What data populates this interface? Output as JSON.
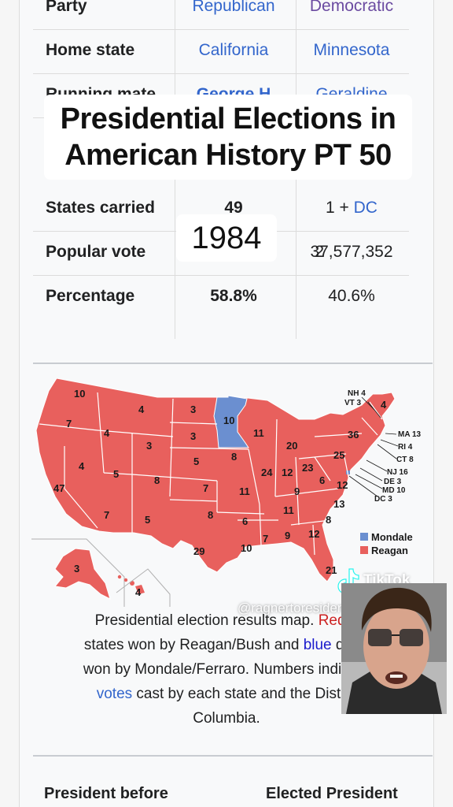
{
  "infobox": {
    "party": {
      "label": "Party",
      "rep": "Republican",
      "dem": "Democratic"
    },
    "home_state": {
      "label": "Home state",
      "rep": "California",
      "dem": "Minnesota"
    },
    "running_mate": {
      "label": "Running mate",
      "rep": "George H",
      "dem": "Geraldine"
    },
    "states_carried": {
      "label": "States carried",
      "rep": "49",
      "dem_num": "1 + ",
      "dem_link": "DC"
    },
    "popular_vote": {
      "label": "Popular vote",
      "rep": "2",
      "dem": "37,577,352"
    },
    "percentage": {
      "label": "Percentage",
      "rep": "58.8%",
      "dem": "40.6%"
    }
  },
  "overlay": {
    "title_line1": "Presidential Elections in",
    "title_line2": "American History PT 50",
    "year": "1984"
  },
  "map": {
    "colors": {
      "reagan": "#e8605d",
      "mondale": "#6b8fd0"
    },
    "legend": {
      "mondale": "Mondale",
      "reagan": "Reagan"
    },
    "state_labels": {
      "WA": "10",
      "OR": "7",
      "CA": "47",
      "NV": "4",
      "ID": "4",
      "MT": "4",
      "WY": "3",
      "UT": "5",
      "AZ": "7",
      "CO": "8",
      "NM": "5",
      "ND": "3",
      "SD": "3",
      "NE": "5",
      "KS": "7",
      "OK": "8",
      "TX": "29",
      "MN": "10",
      "IA": "8",
      "MO": "11",
      "AR": "6",
      "LA": "10",
      "WI": "11",
      "IL": "24",
      "MI": "20",
      "IN": "12",
      "OH": "23",
      "KY": "9",
      "TN": "11",
      "MS": "7",
      "AL": "9",
      "GA": "12",
      "FL": "21",
      "SC": "8",
      "NC": "13",
      "VA": "12",
      "WV": "6",
      "PA": "25",
      "NY": "36",
      "ME": "4",
      "AK": "3",
      "HI": "4",
      "NH": "NH 4",
      "VT": "VT 3",
      "MA": "MA 13",
      "RI": "RI 4",
      "CT": "CT 8",
      "NJ": "NJ 16",
      "DE": "DE 3",
      "MD": "MD 10",
      "DC": "DC 3"
    }
  },
  "caption": {
    "part1": "Presidential election results map. ",
    "red_word": "Red",
    "part2": " d",
    "part3": "states won by Reagan/Bush and ",
    "blue_word": "blue",
    "part4": " deno",
    "part5": "won by Mondale/Ferraro. Numbers indicate ",
    "link_word": "votes",
    "part6": " cast by each state and the Distric",
    "part7": "Columbia."
  },
  "bottom": {
    "left": "President before",
    "right": "Elected President"
  },
  "tiktok": {
    "brand": "TikTok",
    "username": "@ragnertoresident2044"
  }
}
